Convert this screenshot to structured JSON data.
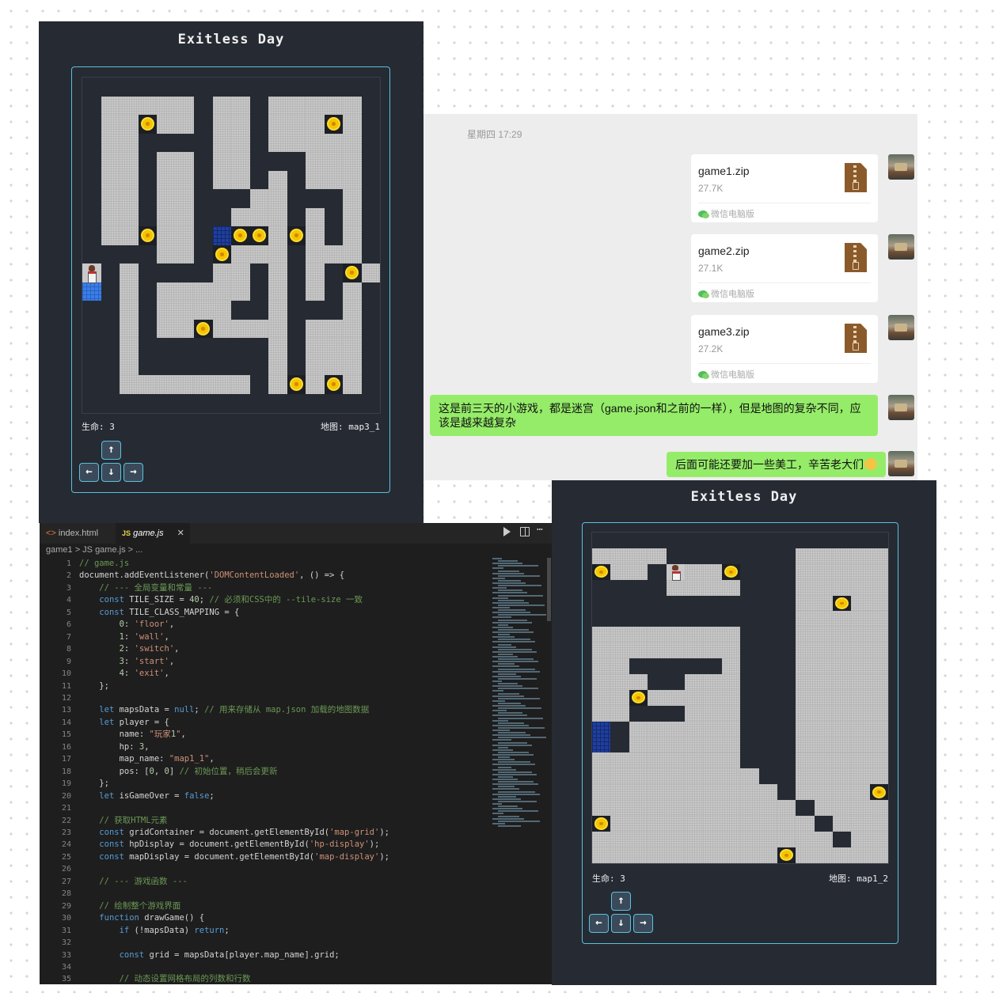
{
  "game1": {
    "title": "Exitless Day",
    "hp_label": "生命: 3",
    "map_label": "地图: map3_1",
    "grid": [
      "1111111111111111",
      "1000001001000001",
      "1002001001000201",
      "1001111001000001",
      "1001001001110001",
      "1001001001010001",
      "1001001110011101",
      "1001001100010101",
      "1002001522020101",
      "1111001200010001",
      "3101111001010120",
      "4101000001010101",
      "1101000011011101",
      "1101002000010001",
      "1101111111010001",
      "1101111111010001",
      "1100000001020201",
      "1111111111111111"
    ]
  },
  "game2": {
    "title": "Exitless Day",
    "hp_label": "生命: 3",
    "map_label": "地图: map1_2",
    "grid": [
      "1111111111111111",
      "0000111111100000",
      "2001300211100000",
      "1111000011100000",
      "1111111111100200",
      "1111111111100000",
      "0000000011100000",
      "0000000011100000",
      "0011111011100000",
      "0001100011100000",
      "0020000011100000",
      "0011100011100000",
      "5100000011100000",
      "5100000011100000",
      "0000000011100000",
      "0000000001100000",
      "0000000000100002",
      "0000000000010000",
      "2000000000001000",
      "0000000000000100",
      "0000000000200000"
    ]
  },
  "controls": {
    "up": "↑",
    "left": "←",
    "down": "↓",
    "right": "→"
  },
  "chat": {
    "time": "星期四 17:29",
    "files": [
      {
        "name": "game1.zip",
        "size": "27.7K",
        "source": "微信电脑版"
      },
      {
        "name": "game2.zip",
        "size": "27.1K",
        "source": "微信电脑版"
      },
      {
        "name": "game3.zip",
        "size": "27.2K",
        "source": "微信电脑版"
      }
    ],
    "message1": "这是前三天的小游戏，都是迷宫（game.json和之前的一样），但是地图的复杂不同，应该是越来越复杂",
    "message2": "后面可能还要加一些美工，辛苦老大们"
  },
  "editor": {
    "tab1": "index.html",
    "tab2": "game.js",
    "breadcrumb": "game1 > JS game.js > ...",
    "lines": [
      "// game.js",
      "document.addEventListener('DOMContentLoaded', () => {",
      "    // --- 全局变量和常量 ---",
      "    const TILE_SIZE = 40; // 必须和CSS中的 --tile-size 一致",
      "    const TILE_CLASS_MAPPING = {",
      "        0: 'floor',",
      "        1: 'wall',",
      "        2: 'switch',",
      "        3: 'start',",
      "        4: 'exit',",
      "    };",
      "",
      "    let mapsData = null; // 用来存储从 map.json 加载的地图数据",
      "    let player = {",
      "        name: \"玩家1\",",
      "        hp: 3,",
      "        map_name: \"map1_1\",",
      "        pos: [0, 0] // 初始位置，稍后会更新",
      "    };",
      "    let isGameOver = false;",
      "",
      "    // 获取HTML元素",
      "    const gridContainer = document.getElementById('map-grid');",
      "    const hpDisplay = document.getElementById('hp-display');",
      "    const mapDisplay = document.getElementById('map-display');",
      "",
      "    // --- 游戏函数 ---",
      "",
      "    // 绘制整个游戏界面",
      "    function drawGame() {",
      "        if (!mapsData) return;",
      "",
      "        const grid = mapsData[player.map_name].grid;",
      "",
      "        // 动态设置网格布局的列数和行数"
    ]
  }
}
